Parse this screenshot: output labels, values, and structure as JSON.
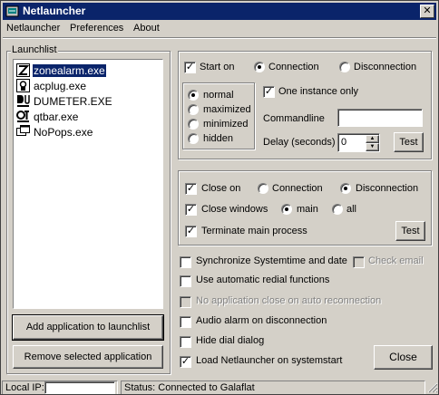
{
  "window": {
    "title": "Netlauncher",
    "close_glyph": "✕"
  },
  "menubar": [
    "Netlauncher",
    "Preferences",
    "About"
  ],
  "launchlist": {
    "label": "Launchlist",
    "items": [
      {
        "name": "zonealarm.exe",
        "selected": true
      },
      {
        "name": "acplug.exe",
        "selected": false
      },
      {
        "name": "DUMETER.EXE",
        "selected": false
      },
      {
        "name": "qtbar.exe",
        "selected": false
      },
      {
        "name": "NoPops.exe",
        "selected": false
      }
    ],
    "add_button": "Add application to launchlist",
    "remove_button": "Remove selected application"
  },
  "start": {
    "start_on_label": "Start on",
    "start_on_checked": true,
    "connection_label": "Connection",
    "disconnection_label": "Disconnection",
    "selected": "Connection",
    "window_states": [
      "normal",
      "maximized",
      "minimized",
      "hidden"
    ],
    "window_state_selected": "normal",
    "one_instance_label": "One instance only",
    "one_instance_checked": true,
    "commandline_label": "Commandline",
    "commandline_value": "",
    "delay_label": "Delay (seconds)",
    "delay_value": "0",
    "test_button": "Test"
  },
  "close": {
    "close_on_label": "Close on",
    "close_on_checked": true,
    "connection_label": "Connection",
    "disconnection_label": "Disconnection",
    "selected": "Disconnection",
    "close_windows_label": "Close windows",
    "close_windows_checked": true,
    "main_label": "main",
    "all_label": "all",
    "windows_selected": "main",
    "terminate_label": "Terminate main process",
    "terminate_checked": true,
    "test_button": "Test"
  },
  "options": {
    "sync_time": {
      "label": "Synchronize Systemtime and date",
      "checked": false
    },
    "check_email": {
      "label": "Check email",
      "checked": false,
      "enabled": false
    },
    "auto_redial": {
      "label": "Use automatic redial functions",
      "checked": false
    },
    "no_app_close": {
      "label": "No application close on auto reconnection",
      "checked": false,
      "enabled": false
    },
    "audio_alarm": {
      "label": "Audio alarm on disconnection",
      "checked": false
    },
    "hide_dial": {
      "label": "Hide dial dialog",
      "checked": false
    },
    "load_on_start": {
      "label": "Load Netlauncher on systemstart",
      "checked": true
    }
  },
  "close_button": "Close",
  "statusbar": {
    "local_ip_label": "Local IP:",
    "local_ip_value": "",
    "status_text": "Status: Connected to Galaflat"
  },
  "colors": {
    "titlebar": "#0a246a",
    "face": "#d4d0c8",
    "selection": "#0a246a"
  },
  "icons": [
    "app-icon",
    "close-icon",
    "spin-up-icon",
    "spin-down-icon",
    "size-grip-icon"
  ]
}
